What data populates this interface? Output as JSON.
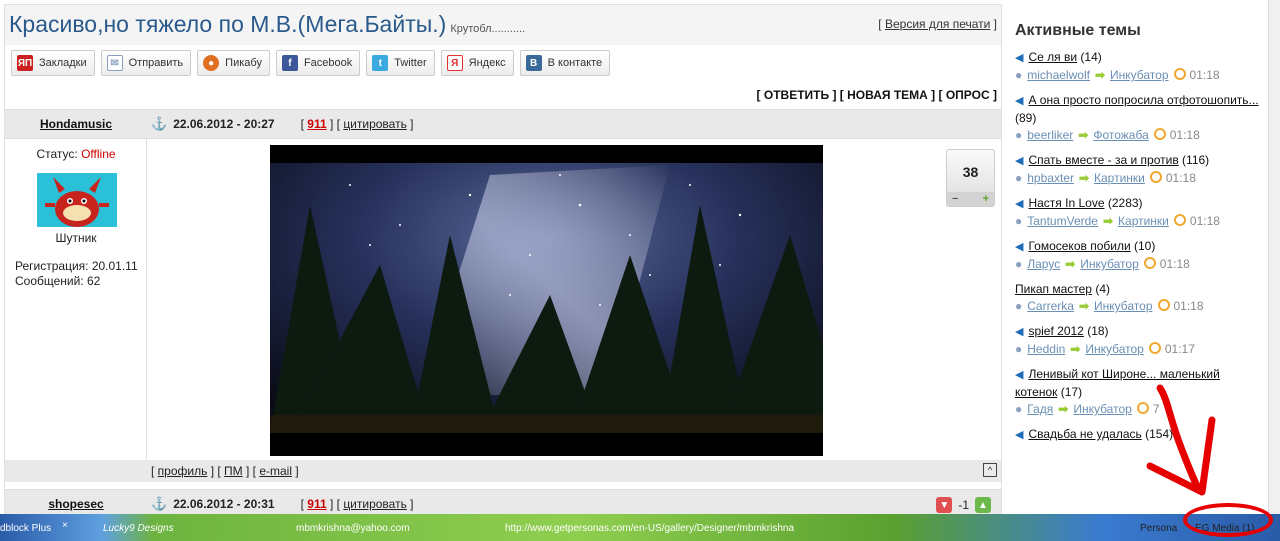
{
  "thread": {
    "title": "Красиво,но тяжело по М.В.(Мега.Байты.)",
    "subtitle": "Крутобл...........",
    "print_link": "Версия для печати"
  },
  "share_buttons": [
    {
      "label": "Закладки",
      "icon": "yap-bookmarks-icon",
      "color": "#cc1f1f"
    },
    {
      "label": "Отправить",
      "icon": "envelope-icon",
      "color": "#8aa0c0"
    },
    {
      "label": "Пикабу",
      "icon": "pikabu-icon",
      "color": "#e07020"
    },
    {
      "label": "Facebook",
      "icon": "facebook-icon",
      "color": "#3b5998"
    },
    {
      "label": "Twitter",
      "icon": "twitter-icon",
      "color": "#3aa9e0"
    },
    {
      "label": "Яндекс",
      "icon": "yandex-icon",
      "color": "#e63030"
    },
    {
      "label": "В контакте",
      "icon": "vk-icon",
      "color": "#3a6a9a"
    }
  ],
  "actions": {
    "reply": "ОТВЕТИТЬ",
    "new_topic": "НОВАЯ ТЕМА",
    "poll": "ОПРОС"
  },
  "post1": {
    "author": "Hondamusic",
    "datetime": "22.06.2012 - 20:27",
    "number": "911",
    "quote": "цитировать",
    "status_label": "Статус:",
    "status_value": "Offline",
    "rank": "Шутник",
    "registration": "Регистрация: 20.01.11",
    "messages": "Сообщений: 62",
    "rating": "38",
    "footer": {
      "profile": "профиль",
      "pm": "ПМ",
      "email": "e-mail"
    }
  },
  "post2": {
    "author": "shopesec",
    "datetime": "22.06.2012 - 20:31",
    "number": "911",
    "quote": "цитировать",
    "rating": "-1"
  },
  "sidebar": {
    "title": "Активные темы",
    "topics": [
      {
        "title": "Се ля ви",
        "count": "(14)",
        "user": "michaelwolf",
        "section": "Инкубатор",
        "time": "01:18",
        "icon": true
      },
      {
        "title": "А она просто попросила отфотошопить...",
        "count": "(89)",
        "user": "beerliker",
        "section": "Фотожаба",
        "time": "01:18",
        "icon": true
      },
      {
        "title": "Спать вместе - за и против",
        "count": "(116)",
        "user": "hpbaxter",
        "section": "Картинки",
        "time": "01:18",
        "icon": true
      },
      {
        "title": "Настя In Love",
        "count": "(2283)",
        "user": "TantumVerde",
        "section": "Картинки",
        "time": "01:18",
        "icon": true
      },
      {
        "title": "Гомосеков побили",
        "count": "(10)",
        "user": "Ларус",
        "section": "Инкубатор",
        "time": "01:18",
        "icon": true
      },
      {
        "title": "Пикап мастер",
        "count": "(4)",
        "user": "Carrerka",
        "section": "Инкубатор",
        "time": "01:18",
        "icon": false
      },
      {
        "title": "spief 2012",
        "count": "(18)",
        "user": "Heddin",
        "section": "Инкубатор",
        "time": "01:17",
        "icon": true
      },
      {
        "title": "Ленивый кот Широне... маленький котенок",
        "count": "(17)",
        "user": "Гадя",
        "section": "Инкубатор",
        "time": "7",
        "icon": true
      },
      {
        "title": "Свадьба не удалась",
        "count": "(154)",
        "user": "",
        "section": "",
        "time": "",
        "icon": true
      }
    ]
  },
  "taskbar": {
    "adblock": "dblock Plus",
    "close": "×",
    "designs": "Lucky9 Designs",
    "email": "mbmkrishna@yahoo.com",
    "url": "http://www.getpersonas.com/en-US/gallery/Designer/mbmkrishna",
    "personas": "Persona",
    "egmedia": "EG Media (1)"
  }
}
